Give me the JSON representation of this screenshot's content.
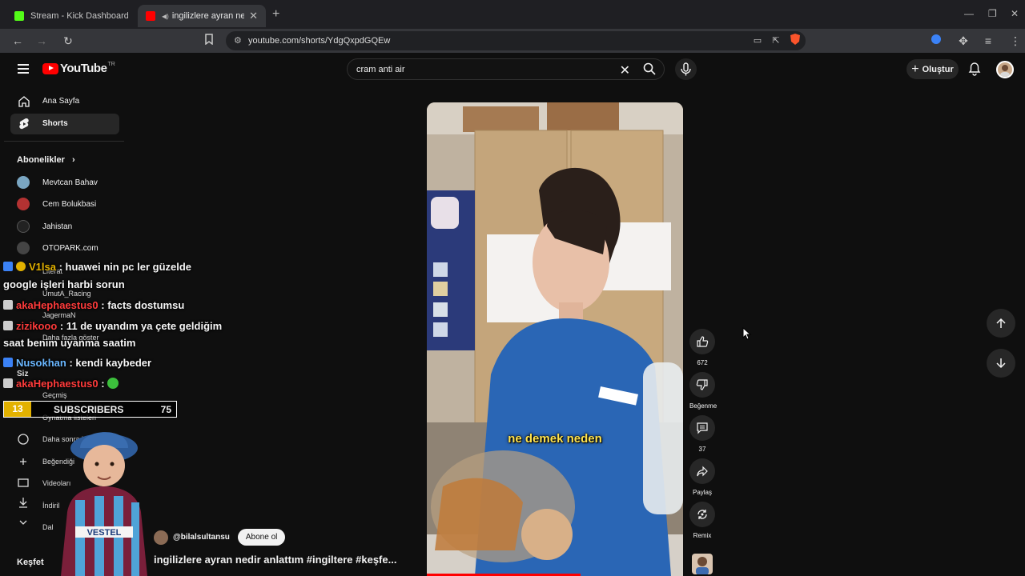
{
  "browser": {
    "tabs": [
      {
        "title": "Stream - Kick Dashboard",
        "favicon": "kick-icon",
        "active": false
      },
      {
        "title": "ingilizlere ayran nedir anlatt",
        "favicon": "youtube-icon",
        "active": true
      }
    ],
    "url": "youtube.com/shorts/YdgQxpdGQEw"
  },
  "youtube": {
    "logo_text": "YouTube",
    "country_code": "TR",
    "search_value": "cram anti air",
    "create_label": "Oluştur",
    "sidebar": {
      "main": [
        {
          "label": "Ana Sayfa",
          "icon": "home-icon"
        },
        {
          "label": "Shorts",
          "icon": "shorts-icon",
          "active": true
        }
      ],
      "subscriptions_title": "Abonelikler",
      "subscriptions": [
        {
          "name": "Mevtcan Bahav",
          "color": "#7aa6c2"
        },
        {
          "name": "Cem Bolukbasi",
          "color": "#b33232"
        },
        {
          "name": "Jahistan",
          "color": "#222222"
        },
        {
          "name": "OTOPARK.com",
          "color": "#444444"
        }
      ],
      "ghost": [
        "Literat",
        "UmutA_Racing",
        "JagermaN",
        "Daha fazla göster",
        "Siz",
        "Geçmiş",
        "Oynatma listeleri",
        "Daha sonra iz",
        "Beğendiği",
        "Videoları",
        "İndiril",
        "Dal"
      ],
      "explore_title": "Keşfet"
    },
    "video": {
      "caption": "ne demek neden",
      "progress_percent": 60,
      "channel": "@bilalsultansu",
      "subscribe_label": "Abone ol",
      "title": "ingilizlere ayran nedir anlattım #ingiltere #keşfe..."
    },
    "actions": {
      "likes": "672",
      "dislike_label": "Beğenme",
      "comments": "37",
      "share_label": "Paylaş",
      "remix_label": "Remix"
    }
  },
  "overlay": {
    "chat": [
      {
        "user": "V1lsa",
        "text": ": huawei nin pc ler güzelde",
        "user_color": "#e2b100"
      },
      {
        "user": "",
        "text": "google işleri harbi sorun",
        "user_color": "#ffffff"
      },
      {
        "user": "akaHephaestus0",
        "text": ": facts dostumsu",
        "user_color": "#ff3b3b"
      },
      {
        "user": "zizikooo",
        "text": ": 11 de uyandım ya çete geldiğim",
        "user_color": "#ff3b3b"
      },
      {
        "user": "",
        "text": "saat benim uyanma saatim",
        "user_color": "#ffffff"
      },
      {
        "user": "Nusokhan",
        "text": ": kendi kaybeder",
        "user_color": "#6ab7ff"
      },
      {
        "user": "akaHephaestus0",
        "text": ":",
        "user_color": "#ff3b3b"
      }
    ],
    "subscribers": {
      "count": "13",
      "label": "SUBSCRIBERS",
      "goal": "75"
    }
  }
}
